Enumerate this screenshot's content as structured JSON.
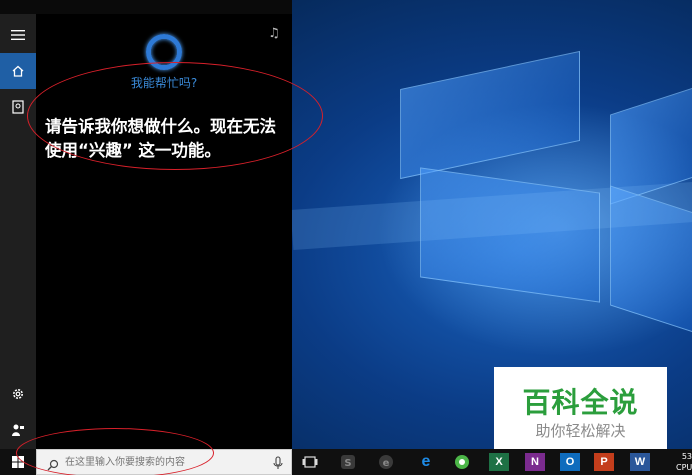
{
  "cortana": {
    "greeting": "我能帮忙吗?",
    "message": "请告诉我你想做什么。现在无法使用“兴趣” 这一功能。"
  },
  "rail": {
    "items": [
      {
        "icon": "hamburger-menu-icon"
      },
      {
        "icon": "home-icon"
      },
      {
        "icon": "notebook-icon"
      },
      {
        "icon": "gear-icon"
      },
      {
        "icon": "feedback-icon"
      }
    ]
  },
  "search": {
    "placeholder": "在这里输入你要搜索的内容"
  },
  "taskbar": {
    "apps": [
      {
        "name": "task-view-icon",
        "label": ""
      },
      {
        "name": "app-unknown-icon",
        "label": ""
      },
      {
        "name": "app-unknown2-icon",
        "label": ""
      },
      {
        "name": "edge-icon",
        "label": "e"
      },
      {
        "name": "chrome-green-icon",
        "label": ""
      },
      {
        "name": "excel-icon",
        "label": "X"
      },
      {
        "name": "onenote-icon",
        "label": "N"
      },
      {
        "name": "outlook-icon",
        "label": "O"
      },
      {
        "name": "powerpoint-icon",
        "label": "P"
      },
      {
        "name": "word-icon",
        "label": "W"
      }
    ],
    "tray": {
      "line1": "53",
      "line2": "CPU"
    }
  },
  "watermark": {
    "title": "百科全说",
    "subtitle": "助你轻松解决"
  },
  "colors": {
    "accent": "#1f5fa5",
    "cortana_blue": "#2e7ad6",
    "annotation_red": "#d8202a"
  }
}
